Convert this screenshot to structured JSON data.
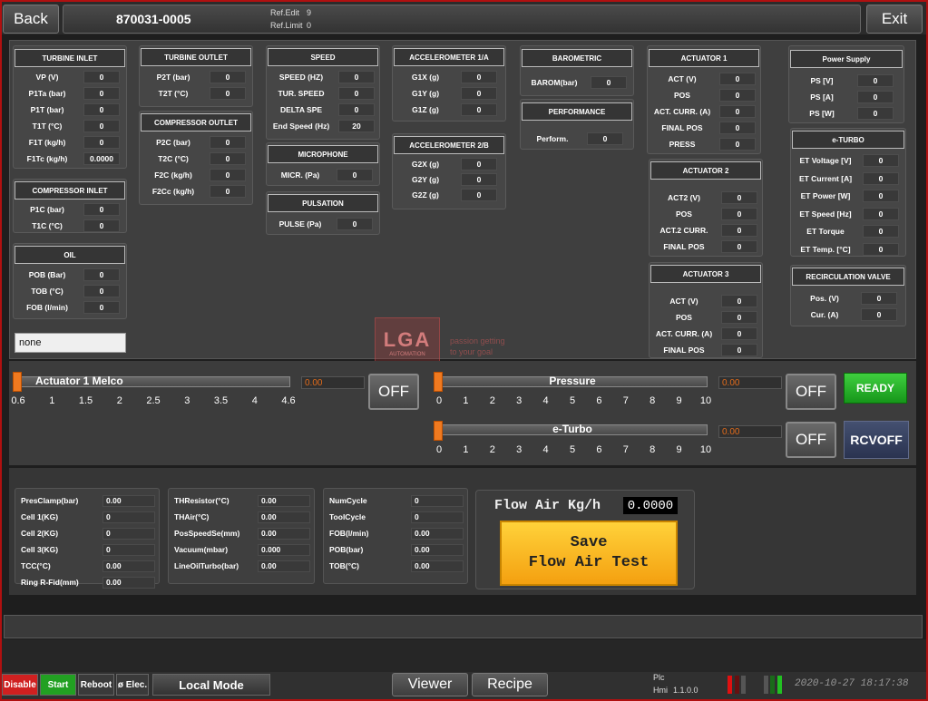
{
  "header": {
    "back_label": "Back",
    "exit_label": "Exit",
    "code": "870031-0005",
    "ref_edit_label": "Ref.Edit",
    "ref_edit_value": "9",
    "ref_limit_label": "Ref.Limit",
    "ref_limit_value": "0"
  },
  "turbine_inlet": {
    "title": "TURBINE INLET",
    "rows": [
      {
        "label": "VP (V)",
        "value": "0"
      },
      {
        "label": "P1Ta (bar)",
        "value": "0"
      },
      {
        "label": "P1T (bar)",
        "value": "0"
      },
      {
        "label": "T1T (°C)",
        "value": "0"
      },
      {
        "label": "F1T (kg/h)",
        "value": "0"
      },
      {
        "label": "F1Tc (kg/h)",
        "value": "0.0000"
      }
    ]
  },
  "compressor_inlet": {
    "title": "COMPRESSOR INLET",
    "rows": [
      {
        "label": "P1C (bar)",
        "value": "0"
      },
      {
        "label": "T1C (°C)",
        "value": "0"
      }
    ]
  },
  "oil": {
    "title": "OIL",
    "rows": [
      {
        "label": "POB (Bar)",
        "value": "0"
      },
      {
        "label": "TOB (°C)",
        "value": "0"
      },
      {
        "label": "FOB (l/min)",
        "value": "0"
      }
    ]
  },
  "none_field": "none",
  "turbine_outlet": {
    "title": "TURBINE OUTLET",
    "rows": [
      {
        "label": "P2T (bar)",
        "value": "0"
      },
      {
        "label": "T2T (°C)",
        "value": "0"
      }
    ]
  },
  "compressor_outlet": {
    "title": "COMPRESSOR OUTLET",
    "rows": [
      {
        "label": "P2C (bar)",
        "value": "0"
      },
      {
        "label": "T2C (°C)",
        "value": "0"
      },
      {
        "label": "F2C (kg/h)",
        "value": "0"
      },
      {
        "label": "F2Cc (kg/h)",
        "value": "0"
      }
    ]
  },
  "speed": {
    "title": "SPEED",
    "rows": [
      {
        "label": "SPEED (HZ)",
        "value": "0"
      },
      {
        "label": "TUR. SPEED",
        "value": "0"
      },
      {
        "label": "DELTA SPE",
        "value": "0"
      },
      {
        "label": "End Speed (Hz)",
        "value": "20"
      }
    ]
  },
  "microphone": {
    "title": "MICROPHONE",
    "rows": [
      {
        "label": "MICR. (Pa)",
        "value": "0"
      }
    ]
  },
  "pulsation": {
    "title": "PULSATION",
    "rows": [
      {
        "label": "PULSE (Pa)",
        "value": "0"
      }
    ]
  },
  "accel_1a": {
    "title": "ACCELEROMETER 1/A",
    "rows": [
      {
        "label": "G1X (g)",
        "value": "0"
      },
      {
        "label": "G1Y (g)",
        "value": "0"
      },
      {
        "label": "G1Z (g)",
        "value": "0"
      }
    ]
  },
  "accel_2b": {
    "title": "ACCELEROMETER 2/B",
    "rows": [
      {
        "label": "G2X (g)",
        "value": "0"
      },
      {
        "label": "G2Y (g)",
        "value": "0"
      },
      {
        "label": "G2Z (g)",
        "value": "0"
      }
    ]
  },
  "barometric": {
    "title": "BAROMETRIC",
    "rows": [
      {
        "label": "BAROM(bar)",
        "value": "0"
      }
    ]
  },
  "performance": {
    "title": "PERFORMANCE",
    "rows": [
      {
        "label": "Perform.",
        "value": "0"
      }
    ]
  },
  "actuator1": {
    "title": "ACTUATOR 1",
    "rows": [
      {
        "label": "ACT (V)",
        "value": "0"
      },
      {
        "label": "POS",
        "value": "0"
      },
      {
        "label": "ACT. CURR. (A)",
        "value": "0"
      },
      {
        "label": "FINAL POS",
        "value": "0"
      },
      {
        "label": "PRESS",
        "value": "0"
      }
    ]
  },
  "actuator2": {
    "title": "ACTUATOR 2",
    "rows": [
      {
        "label": "ACT2 (V)",
        "value": "0"
      },
      {
        "label": "POS",
        "value": "0"
      },
      {
        "label": "ACT.2 CURR.",
        "value": "0"
      },
      {
        "label": "FINAL POS",
        "value": "0"
      }
    ]
  },
  "actuator3": {
    "title": "ACTUATOR 3",
    "rows": [
      {
        "label": "ACT (V)",
        "value": "0"
      },
      {
        "label": "POS",
        "value": "0"
      },
      {
        "label": "ACT. CURR. (A)",
        "value": "0"
      },
      {
        "label": "FINAL POS",
        "value": "0"
      }
    ]
  },
  "power_supply": {
    "title": "Power Supply",
    "rows": [
      {
        "label": "PS [V]",
        "value": "0"
      },
      {
        "label": "PS [A]",
        "value": "0"
      },
      {
        "label": "PS [W]",
        "value": "0"
      }
    ]
  },
  "eturbo_panel": {
    "title": "e-TURBO",
    "rows": [
      {
        "label": "ET Voltage [V]",
        "value": "0"
      },
      {
        "label": "ET Current [A]",
        "value": "0"
      },
      {
        "label": "ET Power [W]",
        "value": "0"
      },
      {
        "label": "ET Speed [Hz]",
        "value": "0"
      },
      {
        "label": "ET Torque",
        "value": "0"
      },
      {
        "label": "ET Temp. [°C]",
        "value": "0"
      }
    ]
  },
  "recirc_valve": {
    "title": "RECIRCULATION VALVE",
    "rows": [
      {
        "label": "Pos. (V)",
        "value": "0"
      },
      {
        "label": "Cur. (A)",
        "value": "0"
      }
    ]
  },
  "logo": {
    "big": "LGA",
    "small": "AUTOMATION",
    "slogan1": "passion getting",
    "slogan2": "to your goal"
  },
  "sliders": {
    "actuator1": {
      "label": "Actuator 1 Melco",
      "value": "0.00",
      "ticks": [
        "0.6",
        "1",
        "1.5",
        "2",
        "2.5",
        "3",
        "3.5",
        "4",
        "4.6"
      ],
      "level": 0
    },
    "pressure": {
      "label": "Pressure",
      "value": "0.00",
      "ticks": [
        "0",
        "1",
        "2",
        "3",
        "4",
        "5",
        "6",
        "7",
        "8",
        "9",
        "10"
      ],
      "level": 0
    },
    "eturbo": {
      "label": "e-Turbo",
      "value": "0.00",
      "ticks": [
        "0",
        "1",
        "2",
        "3",
        "4",
        "5",
        "6",
        "7",
        "8",
        "9",
        "10"
      ],
      "level": 0
    }
  },
  "buttons": {
    "off": "OFF",
    "ready": "READY",
    "rcvoff": "RCVOFF"
  },
  "lower_groups": {
    "g1": [
      {
        "label": "PresClamp(bar)",
        "value": "0.00"
      },
      {
        "label": "Cell 1(KG)",
        "value": "0"
      },
      {
        "label": "Cell 2(KG)",
        "value": "0"
      },
      {
        "label": "Cell 3(KG)",
        "value": "0"
      },
      {
        "label": "TCC(°C)",
        "value": "0.00"
      },
      {
        "label": "Ring R-Fid(mm)",
        "value": "0.00"
      }
    ],
    "g2": [
      {
        "label": "THResistor(°C)",
        "value": "0.00"
      },
      {
        "label": "THAir(°C)",
        "value": "0.00"
      },
      {
        "label": "PosSpeedSe(mm)",
        "value": "0.00"
      },
      {
        "label": "Vacuum(mbar)",
        "value": "0.000"
      },
      {
        "label": "LineOilTurbo(bar)",
        "value": "0.00"
      }
    ],
    "g3": [
      {
        "label": "NumCycle",
        "value": "0"
      },
      {
        "label": "ToolCycle",
        "value": "0"
      },
      {
        "label": "FOB(l/min)",
        "value": "0.00"
      },
      {
        "label": "POB(bar)",
        "value": "0.00"
      },
      {
        "label": "TOB(°C)",
        "value": "0.00"
      }
    ]
  },
  "flow": {
    "label": "Flow Air Kg/h",
    "value": "0.0000",
    "save_line1": "Save",
    "save_line2": "Flow Air Test"
  },
  "bottom": {
    "disable": "Disable",
    "start": "Start",
    "reboot": "Reboot",
    "elec": "ø Elec.",
    "mode": "Local Mode",
    "viewer": "Viewer",
    "recipe": "Recipe",
    "plc_label": "Plc",
    "hmi_label": "Hmi",
    "hmi_version": "1.1.0.0",
    "datetime": "2020-10-27 18:17:38"
  }
}
